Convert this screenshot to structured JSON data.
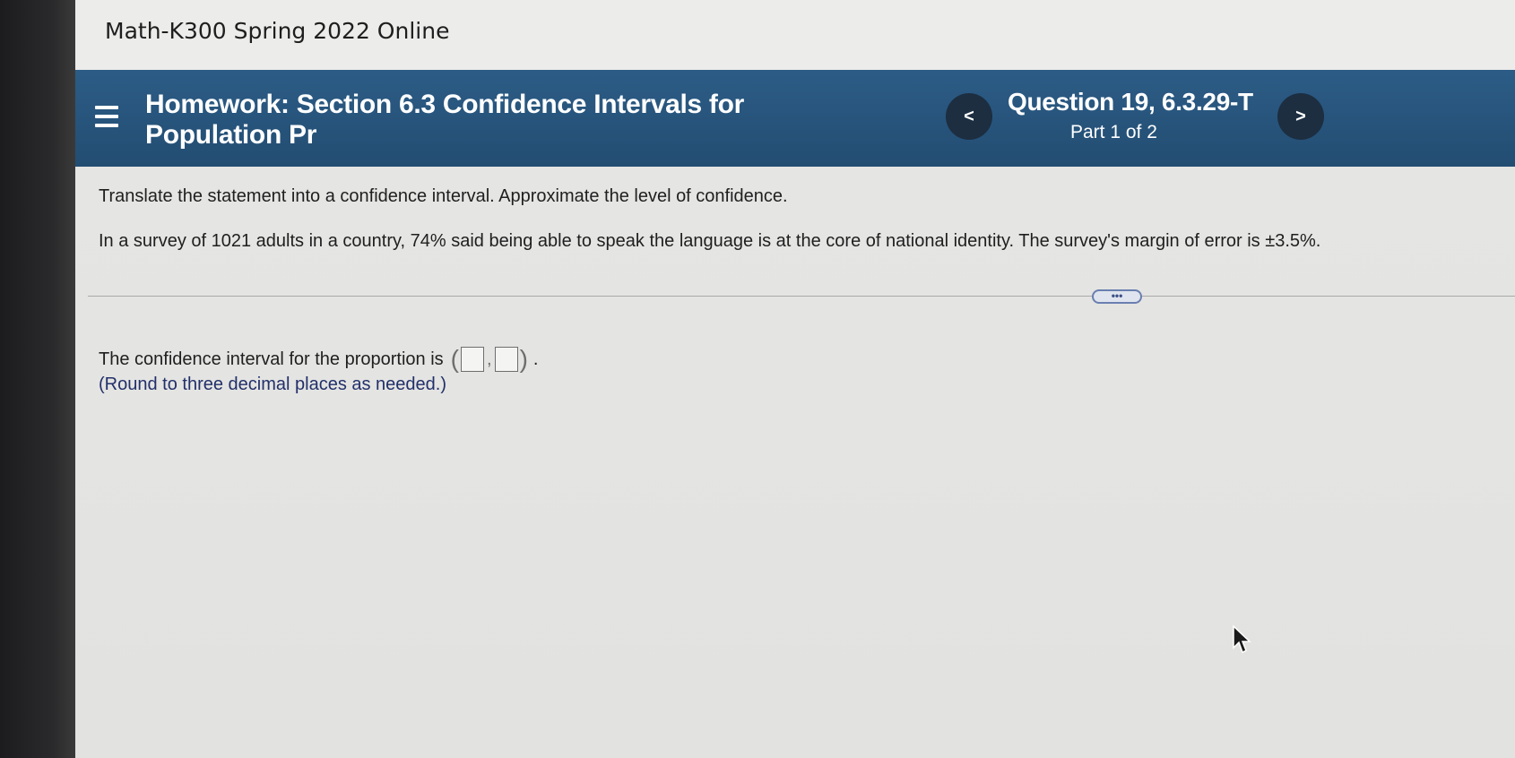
{
  "course": {
    "title": "Math-K300 Spring 2022 Online"
  },
  "header": {
    "homework_title": "Homework: Section 6.3 Confidence Intervals for Population Pr",
    "question_id": "Question 19, 6.3.29-T",
    "part": "Part 1 of 2",
    "prev_label": "<",
    "next_label": ">"
  },
  "question": {
    "instruction": "Translate the statement into a confidence interval. Approximate the level of confidence.",
    "problem": "In a survey of 1021 adults in a country, 74% said being able to speak the language is at the core of national identity. The survey's margin of error is ±3.5%.",
    "more_label": "•••",
    "answer_prompt": "The confidence interval for the proportion is",
    "interval_open": "(",
    "interval_sep": ",",
    "interval_close": ")",
    "answer_tail": ".",
    "round_note": "(Round to three decimal places as needed.)"
  },
  "colors": {
    "header_bg": "#2c5c86",
    "nav_button_bg": "#1c2e40",
    "note_text": "#22306a"
  }
}
